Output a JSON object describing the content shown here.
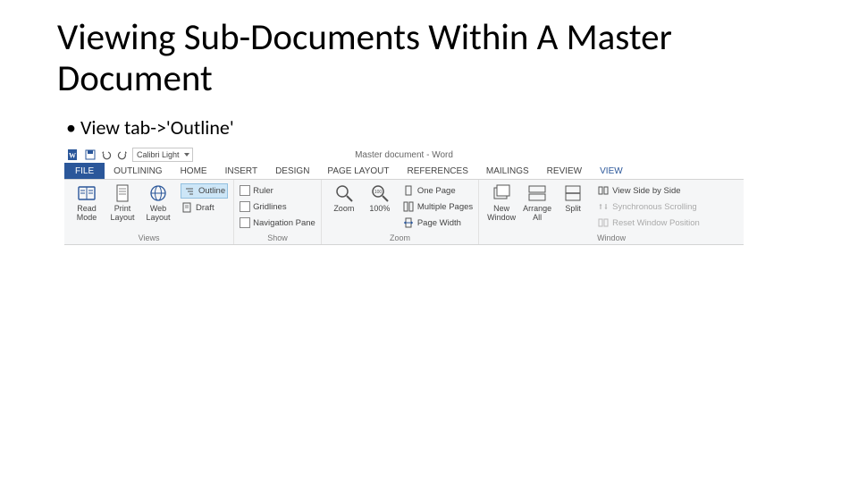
{
  "slide": {
    "title": "Viewing Sub-Documents Within A Master Document",
    "bullet1": "View tab->'Outline'"
  },
  "word": {
    "doc_title": "Master document - Word",
    "qat_font": "Calibri Light",
    "tabs": {
      "file": "FILE",
      "outlining": "OUTLINING",
      "home": "HOME",
      "insert": "INSERT",
      "design": "DESIGN",
      "page_layout": "PAGE LAYOUT",
      "references": "REFERENCES",
      "mailings": "MAILINGS",
      "review": "REVIEW",
      "view": "VIEW"
    },
    "ribbon": {
      "views": {
        "read_mode": "Read Mode",
        "print_layout": "Print Layout",
        "web_layout": "Web Layout",
        "outline": "Outline",
        "draft": "Draft",
        "group": "Views"
      },
      "show": {
        "ruler": "Ruler",
        "gridlines": "Gridlines",
        "nav": "Navigation Pane",
        "group": "Show"
      },
      "zoom": {
        "zoom": "Zoom",
        "hundred": "100%",
        "one_page": "One Page",
        "multi": "Multiple Pages",
        "width": "Page Width",
        "group": "Zoom"
      },
      "window": {
        "new": "New Window",
        "arrange": "Arrange All",
        "split": "Split",
        "side": "View Side by Side",
        "sync": "Synchronous Scrolling",
        "reset": "Reset Window Position",
        "group": "Window"
      }
    }
  }
}
